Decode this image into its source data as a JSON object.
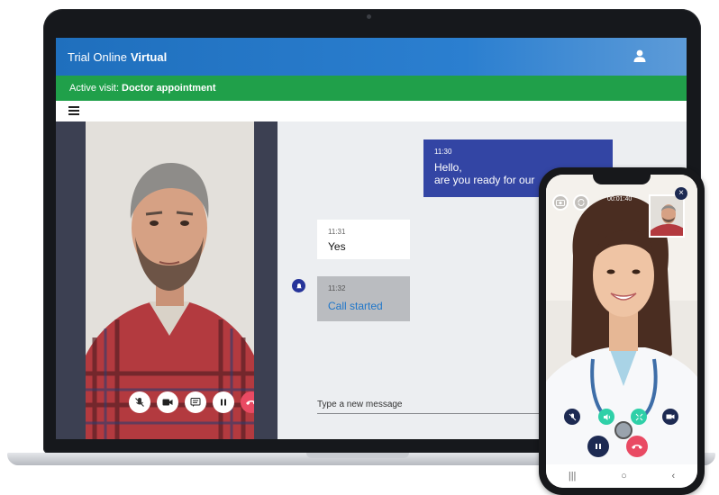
{
  "app": {
    "brand_prefix": "Trial Online",
    "brand_name": "Virtual"
  },
  "visit": {
    "label": "Active visit:",
    "name": "Doctor appointment"
  },
  "chat": {
    "messages": [
      {
        "time": "11:30",
        "line1": "Hello,",
        "line2": "are you ready for our"
      },
      {
        "time": "11:31",
        "text": "Yes"
      },
      {
        "time": "11:32",
        "text": "Call started"
      }
    ],
    "input": {
      "placeholder": "Type a new message"
    }
  },
  "call_controls": [
    "mic-muted-icon",
    "video-icon",
    "chat-icon",
    "pause-icon",
    "end-call-icon"
  ],
  "phone": {
    "timer": "00:01:40",
    "close_label": "×",
    "nav": {
      "recent": "|||",
      "home": "○",
      "back": "‹"
    }
  },
  "colors": {
    "topbar": "#1f6fbd",
    "visitbar": "#20a04a",
    "outgoing_bubble": "#3345a4",
    "end_call": "#e94a63",
    "accent_teal": "#2fd0a8"
  }
}
